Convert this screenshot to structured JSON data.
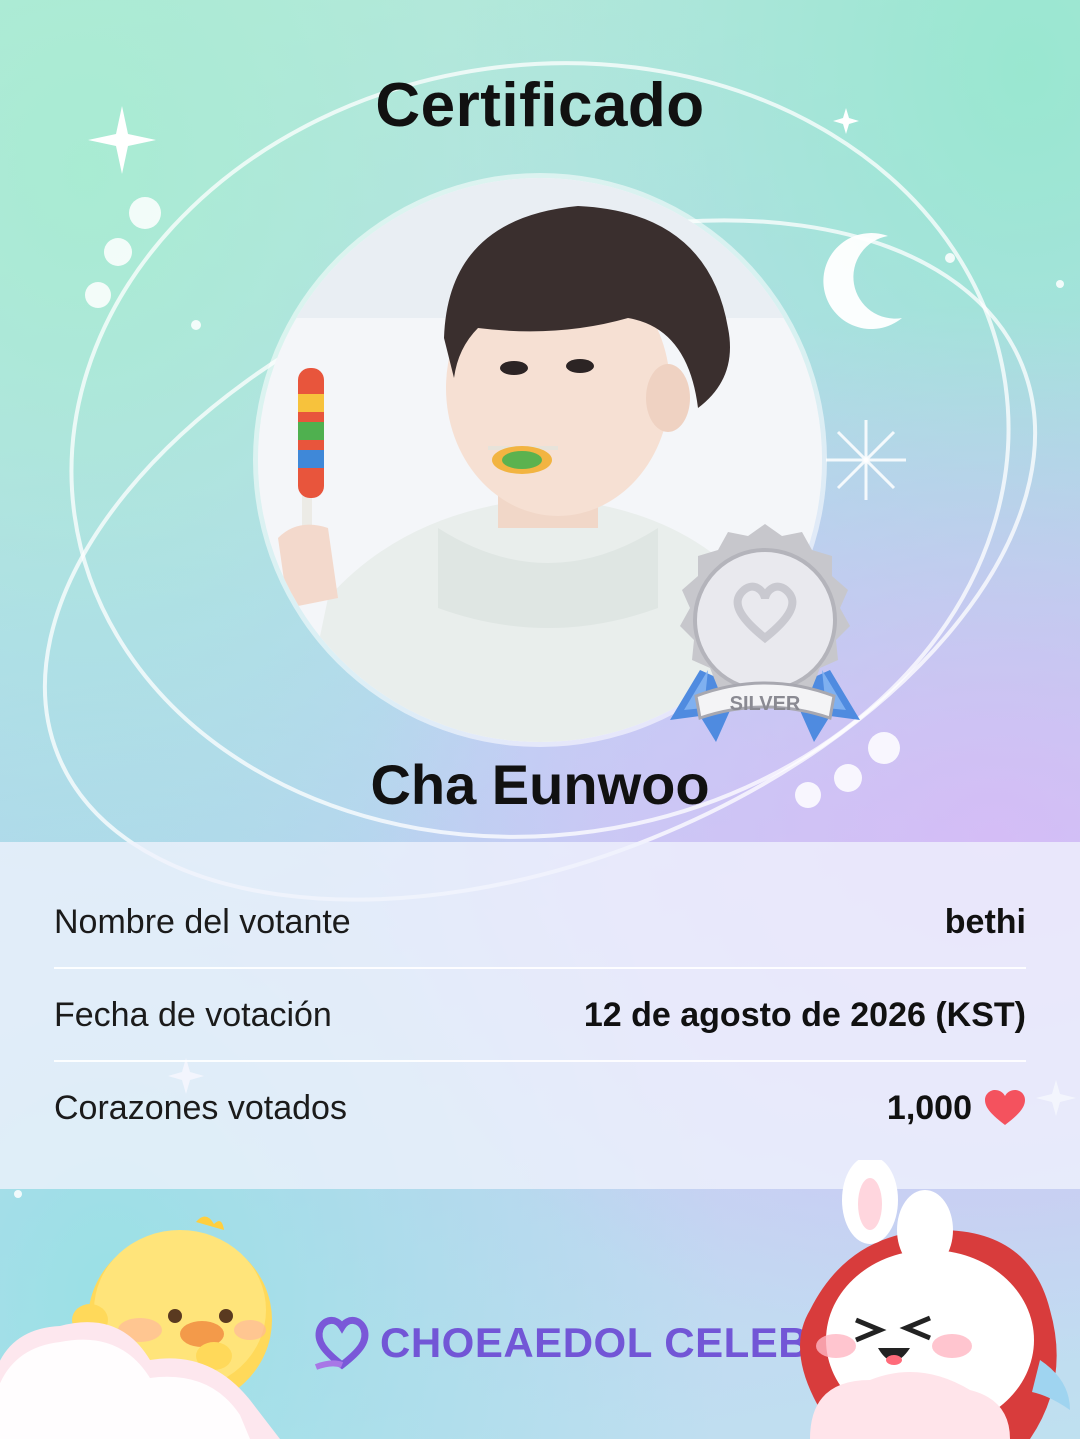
{
  "certificate": {
    "title": "Certificado",
    "celeb_name": "Cha Eunwoo",
    "badge_tier": "SILVER"
  },
  "info": {
    "rows": [
      {
        "label": "Nombre del votante",
        "value": "bethi"
      },
      {
        "label": "Fecha de votación",
        "value": "12 de agosto de 2026 (KST)"
      },
      {
        "label": "Corazones votados",
        "value": "1,000"
      }
    ]
  },
  "brand": {
    "name": "CHOEAEDOL CELEB"
  },
  "icons": {
    "heart": "heart-icon",
    "badge": "silver-medal-icon",
    "logo": "choeaedol-logo-icon"
  },
  "colors": {
    "heart": "#f4525e",
    "brand": "#7256d6",
    "badge_ribbon": "#4f8be0"
  }
}
